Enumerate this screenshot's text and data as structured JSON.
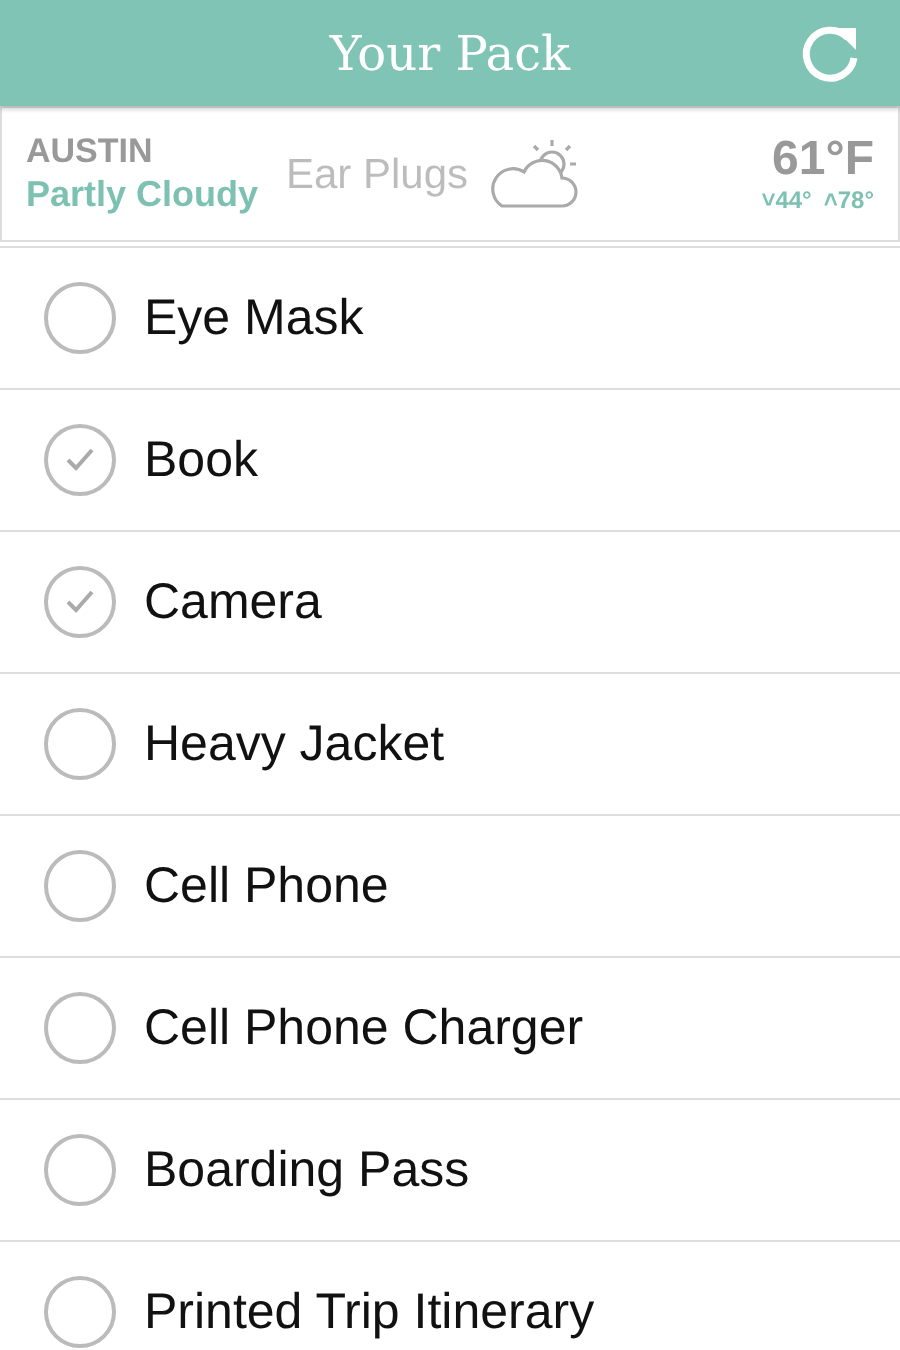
{
  "header": {
    "title": "Your Pack"
  },
  "weather": {
    "city": "AUSTIN",
    "condition": "Partly Cloudy",
    "temperature": "61°F",
    "low": "˅44°",
    "high": "˄78°"
  },
  "covered_item": {
    "label": "Ear Plugs"
  },
  "items": [
    {
      "label": "Eye Mask",
      "checked": false
    },
    {
      "label": "Book",
      "checked": true
    },
    {
      "label": "Camera",
      "checked": true
    },
    {
      "label": "Heavy Jacket",
      "checked": false
    },
    {
      "label": "Cell Phone",
      "checked": false
    },
    {
      "label": "Cell Phone Charger",
      "checked": false
    },
    {
      "label": "Boarding Pass",
      "checked": false
    },
    {
      "label": "Printed Trip Itinerary",
      "checked": false
    }
  ]
}
